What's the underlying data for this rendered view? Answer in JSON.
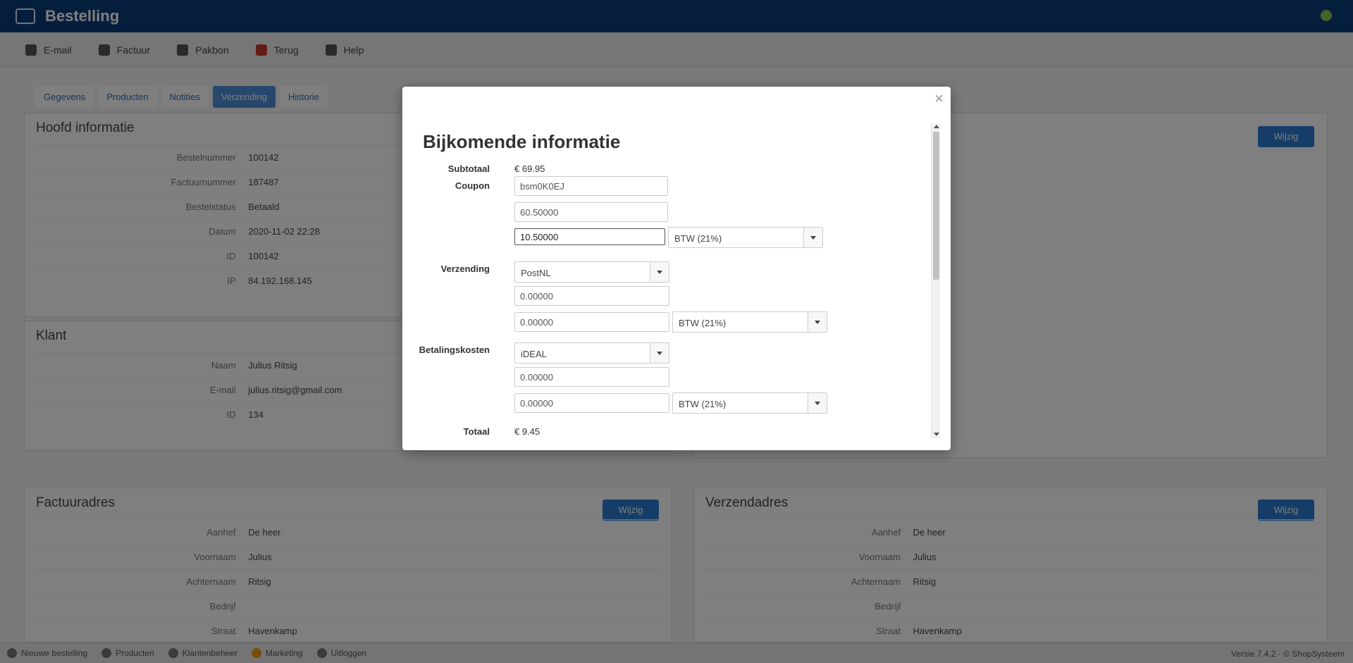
{
  "app": {
    "title": "Bestelling",
    "toolbar": [
      "E-mail",
      "Factuur",
      "Pakbon",
      "Terug",
      "Help"
    ],
    "tabs": [
      "Gegevens",
      "Producten",
      "Notities",
      "Verzending",
      "Historie"
    ]
  },
  "panels": {
    "hoofd": {
      "title": "Hoofd informatie",
      "rows": [
        {
          "label": "Bestelnummer",
          "value": "100142"
        },
        {
          "label": "Factuurnummer",
          "value": "187487"
        },
        {
          "label": "Bestelstatus",
          "value": "Betaald"
        },
        {
          "label": "Datum",
          "value": "2020-11-02 22:28"
        },
        {
          "label": "ID",
          "value": "100142"
        },
        {
          "label": "IP",
          "value": "84.192.168.145"
        }
      ]
    },
    "klant": {
      "title": "Klant",
      "rows": [
        {
          "label": "Naam",
          "value": "Julius Ritsig"
        },
        {
          "label": "E-mail",
          "value": "julius.ritsig@gmail.com"
        },
        {
          "label": "ID",
          "value": "134"
        }
      ]
    },
    "factuur": {
      "title": "Factuuradres",
      "rows": [
        {
          "label": "Aanhef",
          "value": "De heer"
        },
        {
          "label": "Voornaam",
          "value": "Julius"
        },
        {
          "label": "Achternaam",
          "value": "Ritsig"
        },
        {
          "label": "Bedrijf",
          "value": ""
        },
        {
          "label": "Straat",
          "value": "Havenkamp"
        }
      ]
    },
    "verzend": {
      "title": "Verzendadres",
      "rows": [
        {
          "label": "Aanhef",
          "value": "De heer"
        },
        {
          "label": "Voornaam",
          "value": "Julius"
        },
        {
          "label": "Achternaam",
          "value": "Ritsig"
        },
        {
          "label": "Bedrijf",
          "value": ""
        },
        {
          "label": "Straat",
          "value": "Havenkamp"
        }
      ]
    },
    "edit_label": "Wijzig"
  },
  "statusbar": {
    "items": [
      "Nieuwe bestelling",
      "Producten",
      "Klantenbeheer",
      "Marketing",
      "Uitloggen"
    ],
    "right": "Versie 7.4.2 · © ShopSysteem"
  },
  "modal": {
    "title": "Bijkomende informatie",
    "close_label": "×",
    "subtotal": {
      "label": "Subtotaal",
      "value": "€ 69.95"
    },
    "coupon": {
      "label": "Coupon",
      "code": "bsm0K0EJ",
      "amount": "60.50000",
      "tax_amount": "10.50000",
      "tax_select": "BTW (21%)"
    },
    "verzending": {
      "label": "Verzending",
      "method": "PostNL",
      "amount": "0.00000",
      "tax_amount": "0.00000",
      "tax_select": "BTW (21%)"
    },
    "betaling": {
      "label": "Betalingskosten",
      "method": "iDEAL",
      "amount": "0.00000",
      "tax_amount": "0.00000",
      "tax_select": "BTW (21%)"
    },
    "total": {
      "label": "Totaal",
      "value": "€ 9.45"
    }
  }
}
